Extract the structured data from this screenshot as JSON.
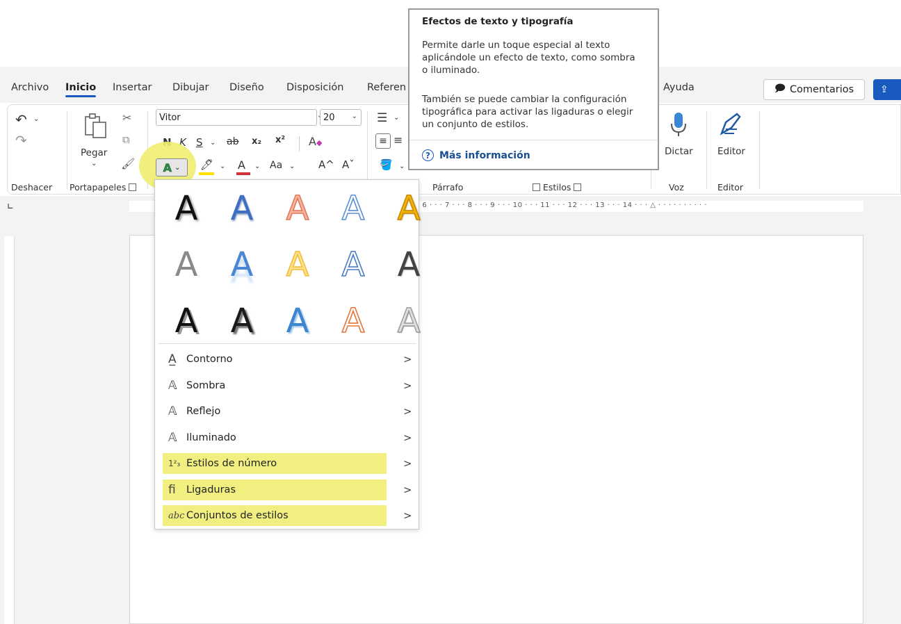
{
  "tabs": [
    "Archivo",
    "Inicio",
    "Insertar",
    "Dibujar",
    "Diseño",
    "Disposición",
    "Referen",
    "Ayuda"
  ],
  "actions": {
    "comments_label": "Comentarios"
  },
  "ribbon": {
    "groups": {
      "undo": "Deshacer",
      "clipboard": "Portapapeles",
      "paragraph": "Párrafo",
      "styles": "Estilos",
      "voice": "Voz",
      "editor": "Editor"
    },
    "clipboard": {
      "paste_label": "Pegar"
    },
    "font": {
      "name": "Vitor",
      "size": "20",
      "bold": "N",
      "italic": "K",
      "underline": "S",
      "strike": "ab",
      "subscript": "x₂",
      "superscript": "x²",
      "change_case": "Aa",
      "grow": "A^",
      "shrink": "Aˇ"
    },
    "voice": {
      "dictate_label": "Dictar"
    },
    "editor": {
      "editor_label": "Editor"
    }
  },
  "ruler": {
    "ticks": "· 6 · · · 7 · · · 8 · · · 9 · · · 10 · · · 11 · · · 12 · · · 13 · · · 14 · · · △ · · · · · · · · · ·"
  },
  "menu": {
    "gallery": [
      {
        "glyph": "A",
        "fill": "#111111",
        "stroke": "none",
        "shadow": "2px 2px 3px rgba(0,0,0,0.45)"
      },
      {
        "glyph": "A",
        "fill": "#3d6fc4",
        "stroke": "none",
        "shadow": "1px 2px 2px rgba(30,60,120,0.5)"
      },
      {
        "glyph": "A",
        "fill": "#f6b5a0",
        "stroke": "#e07b5a",
        "shadow": "none"
      },
      {
        "glyph": "A",
        "fill": "#ffffff",
        "stroke": "#5b8fd6",
        "shadow": "none"
      },
      {
        "glyph": "A",
        "fill": "#f2b30c",
        "stroke": "#c98a00",
        "shadow": "1px 1px 2px rgba(120,80,0,0.5)"
      },
      {
        "glyph": "A",
        "fill": "#8a8a8a",
        "stroke": "none",
        "shadow": "none"
      },
      {
        "glyph": "A",
        "fill": "#4a86d6",
        "stroke": "none",
        "shadow": "0px 10px 3px rgba(74,134,214,0.25)"
      },
      {
        "glyph": "A",
        "fill": "#ffe08a",
        "stroke": "#f0c040",
        "shadow": "none"
      },
      {
        "glyph": "A",
        "fill": "#ffffff",
        "stroke": "#4a7bc8",
        "shadow": "none"
      },
      {
        "glyph": "A",
        "fill": "#444444",
        "stroke": "none",
        "shadow": "1px 1px 1px #bbb"
      },
      {
        "glyph": "A",
        "fill": "#111111",
        "stroke": "none",
        "shadow": "3px 3px 0 #9a9a9a"
      },
      {
        "glyph": "A",
        "fill": "#1a1a1a",
        "stroke": "none",
        "shadow": "3px 3px 2px #6d6d6d"
      },
      {
        "glyph": "A",
        "fill": "#3d86cf",
        "stroke": "none",
        "shadow": "2px 2px 2px #9cc3ea"
      },
      {
        "glyph": "A",
        "fill": "#ffffff",
        "stroke": "#e8743b",
        "shadow": "none"
      },
      {
        "glyph": "A",
        "fill": "#e0e0e0",
        "stroke": "#a0a0a0",
        "shadow": "1px 1px 1px #888"
      }
    ],
    "items": [
      {
        "label": "Contorno",
        "icon": "text-outline-icon",
        "glyph": "A̲",
        "highlighted": false
      },
      {
        "label": "Sombra",
        "icon": "text-shadow-icon",
        "glyph": "𝔸",
        "highlighted": false
      },
      {
        "label": "Reflejo",
        "icon": "text-reflection-icon",
        "glyph": "𝔸",
        "highlighted": false
      },
      {
        "label": "Iluminado",
        "icon": "text-glow-icon",
        "glyph": "𝔸",
        "highlighted": false
      },
      {
        "label": "Estilos de número",
        "icon": "number-styles-icon",
        "glyph": "1²₃",
        "highlighted": true
      },
      {
        "label": "Ligaduras",
        "icon": "ligatures-icon",
        "glyph": "ﬁ",
        "highlighted": true
      },
      {
        "label": "Conjuntos de estilos",
        "icon": "stylistic-sets-icon",
        "glyph": "abc",
        "highlighted": true
      }
    ],
    "arrow": ">"
  },
  "tooltip": {
    "title": "Efectos de texto y tipografía",
    "p1": [
      "Permite darle un toque especial al texto",
      "aplicándole un efecto de texto, como sombra",
      "o iluminado."
    ],
    "p2": [
      "También se puede cambiar la configuración",
      "tipográfica para activar las ligaduras o elegir",
      "un conjunto de estilos."
    ],
    "more": "Más información"
  },
  "colors": {
    "accent": "#185abd",
    "highlight": "#f1ef80",
    "font_color": "#d13438",
    "highlighter": "#ffe000"
  }
}
